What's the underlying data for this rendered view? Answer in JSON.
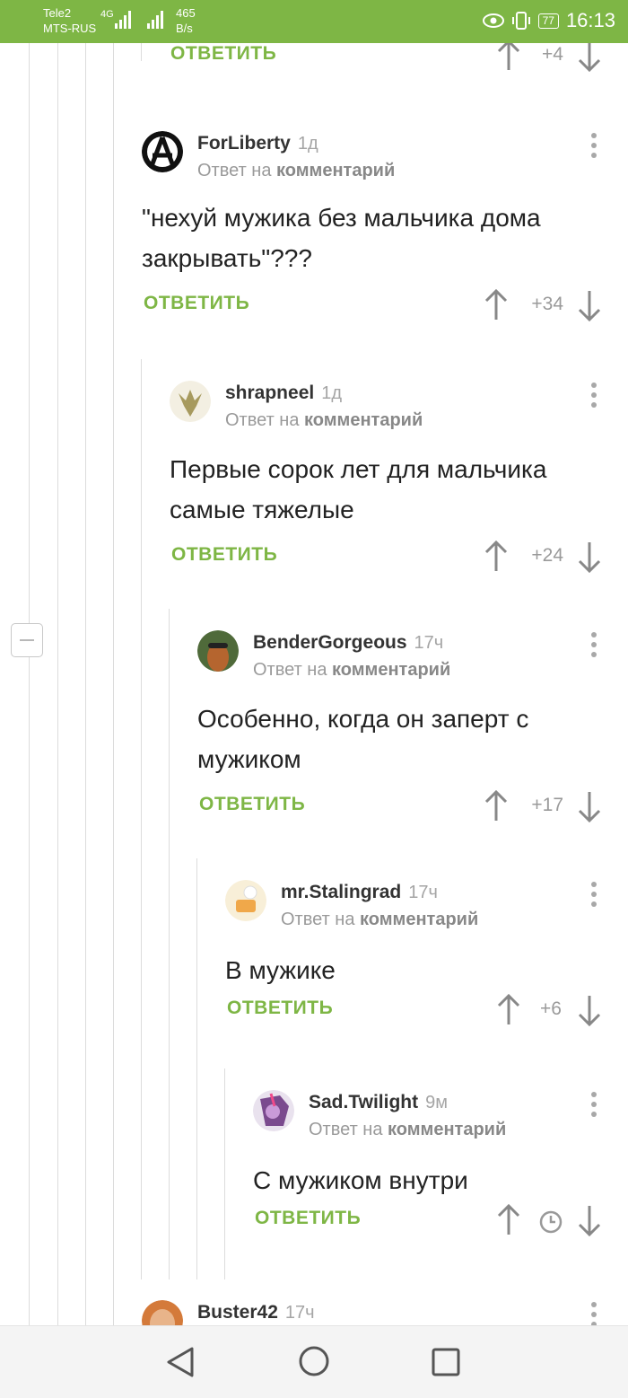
{
  "status": {
    "carrier1": "Tele2",
    "carrier2": "MTS-RUS",
    "net_type": "4G",
    "speed_value": "465",
    "speed_unit": "B/s",
    "battery": "77",
    "time": "16:13"
  },
  "top_partial": {
    "reply_label": "ОТВЕТИТЬ",
    "score": "+4"
  },
  "comments": [
    {
      "user": "ForLiberty",
      "time": "1д",
      "reply_prefix": "Ответ на",
      "reply_target": "комментарий",
      "text": "\"нехуй мужика без мальчика дома закрывать\"???",
      "reply_label": "ОТВЕТИТЬ",
      "score": "+34"
    },
    {
      "user": "shrapneel",
      "time": "1д",
      "reply_prefix": "Ответ на",
      "reply_target": "комментарий",
      "text": "Первые сорок лет для мальчика самые тяжелые",
      "reply_label": "ОТВЕТИТЬ",
      "score": "+24"
    },
    {
      "user": "BenderGorgeous",
      "time": "17ч",
      "reply_prefix": "Ответ на",
      "reply_target": "комментарий",
      "text": "Особенно, когда он заперт с мужиком",
      "reply_label": "ОТВЕТИТЬ",
      "score": "+17"
    },
    {
      "user": "mr.Stalingrad",
      "time": "17ч",
      "reply_prefix": "Ответ на",
      "reply_target": "комментарий",
      "text": "В мужике",
      "reply_label": "ОТВЕТИТЬ",
      "score": "+6"
    },
    {
      "user": "Sad.Twilight",
      "time": "9м",
      "reply_prefix": "Ответ на",
      "reply_target": "комментарий",
      "text": "С мужиком внутри",
      "reply_label": "ОТВЕТИТЬ",
      "score_icon": "clock-icon"
    },
    {
      "user": "Buster42",
      "time": "17ч"
    }
  ],
  "colors": {
    "accent": "#7eb645",
    "muted": "#9a9a9a"
  },
  "icons": [
    "arrow-up-icon",
    "arrow-down-icon",
    "kebab-menu-icon",
    "clock-icon",
    "collapse-icon",
    "nav-back-icon",
    "nav-home-icon",
    "nav-recents-icon"
  ]
}
